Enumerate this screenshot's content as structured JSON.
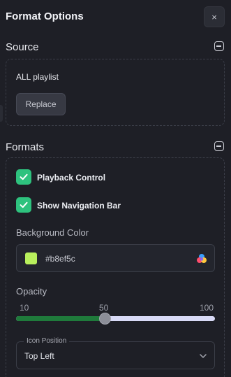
{
  "header": {
    "title": "Format Options",
    "close_label": "×"
  },
  "source": {
    "title": "Source",
    "playlist_label": "ALL playlist",
    "replace_label": "Replace"
  },
  "formats": {
    "title": "Formats",
    "checkboxes": [
      {
        "label": "Playback Control",
        "checked": true
      },
      {
        "label": "Show Navigation Bar",
        "checked": true
      }
    ],
    "background_color": {
      "label": "Background Color",
      "value": "#b8ef5c",
      "swatch": "#b8ef5c"
    },
    "opacity": {
      "label": "Opacity",
      "min": "10",
      "current": "50",
      "max": "100",
      "value_fraction": 0.444
    },
    "icon_position": {
      "legend": "Icon Position",
      "value": "Top Left"
    }
  },
  "colors": {
    "accent_check": "#2ec27e",
    "slider_fill": "#1f7a3b",
    "slider_track": "#d8daf6"
  },
  "icons": [
    "close-icon",
    "collapse-icon",
    "check-icon",
    "palette-icon",
    "chevron-down-icon"
  ]
}
